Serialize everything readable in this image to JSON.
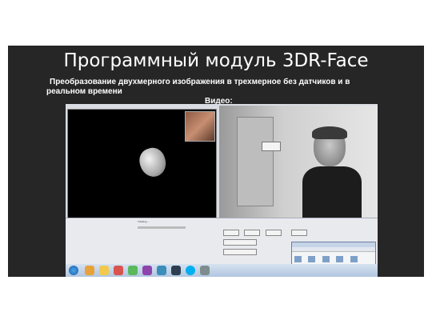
{
  "slide": {
    "title": "Программный модуль 3DR-Face",
    "subtitle": "Преобразование двухмерного изображения в трехмерное без датчиков и в реальном времени",
    "video_label": "Видео:"
  },
  "screenshot": {
    "camera_sign": "",
    "panel_texts": [
      "Tracking ...",
      "Start capture",
      "Listen",
      "Overview",
      "Stop data",
      "Tracking"
    ],
    "tray_time": "",
    "tray_date": ""
  },
  "colors": {
    "slide_bg": "#262626",
    "title": "#ffffff",
    "taskbar": "#aec4de"
  },
  "icons": [
    "windows-start-icon",
    "browser-icon",
    "folder-icon",
    "media-icon",
    "app-icon",
    "chat-icon",
    "mail-icon",
    "terminal-icon",
    "skype-icon",
    "settings-icon"
  ]
}
